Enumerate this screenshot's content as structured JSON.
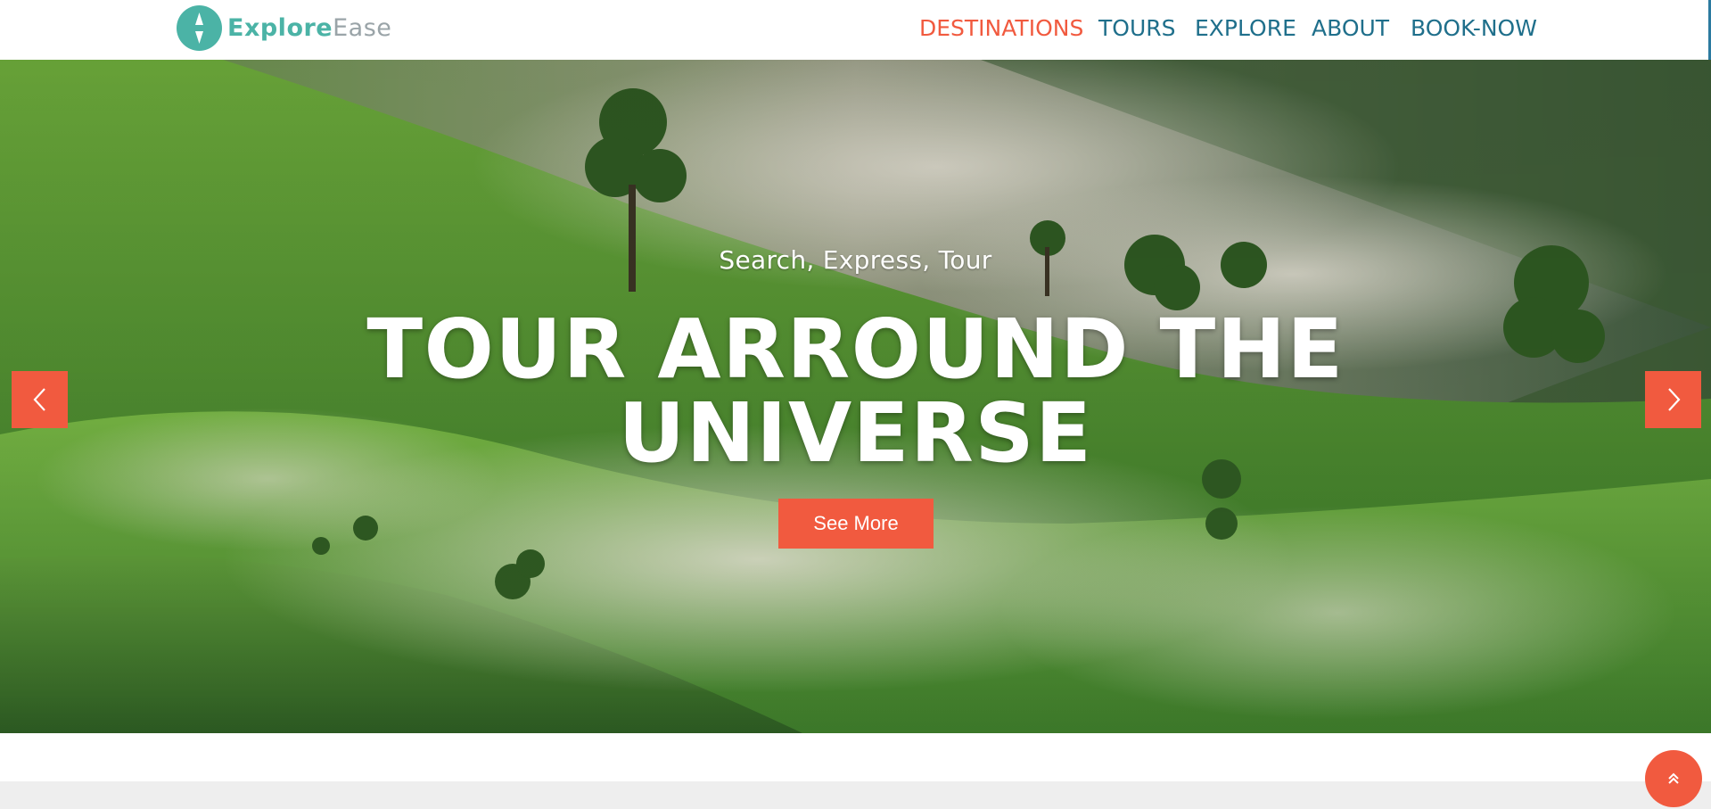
{
  "brand": {
    "name_strong": "Explore",
    "name_light": "Ease",
    "icon": "compass-icon"
  },
  "nav": {
    "items": [
      {
        "label": "DESTINATIONS",
        "active": true
      },
      {
        "label": "TOURS",
        "active": false
      },
      {
        "label": "EXPLORE",
        "active": false
      },
      {
        "label": "ABOUT",
        "active": false
      },
      {
        "label": "BOOK-NOW",
        "active": false
      }
    ]
  },
  "hero": {
    "subtitle": "Search, Express, Tour",
    "title_line1": "TOUR ARROUND THE",
    "title_line2": "UNIVERSE",
    "button_label": "See More",
    "prev_icon": "chevron-left-icon",
    "next_icon": "chevron-right-icon"
  },
  "back_to_top": {
    "icon": "double-chevron-up-icon"
  },
  "colors": {
    "accent": "#f15a3f",
    "brand_teal": "#4bb3a6",
    "nav_blue": "#1f6f8b",
    "brand_gray": "#9aa4a8"
  }
}
